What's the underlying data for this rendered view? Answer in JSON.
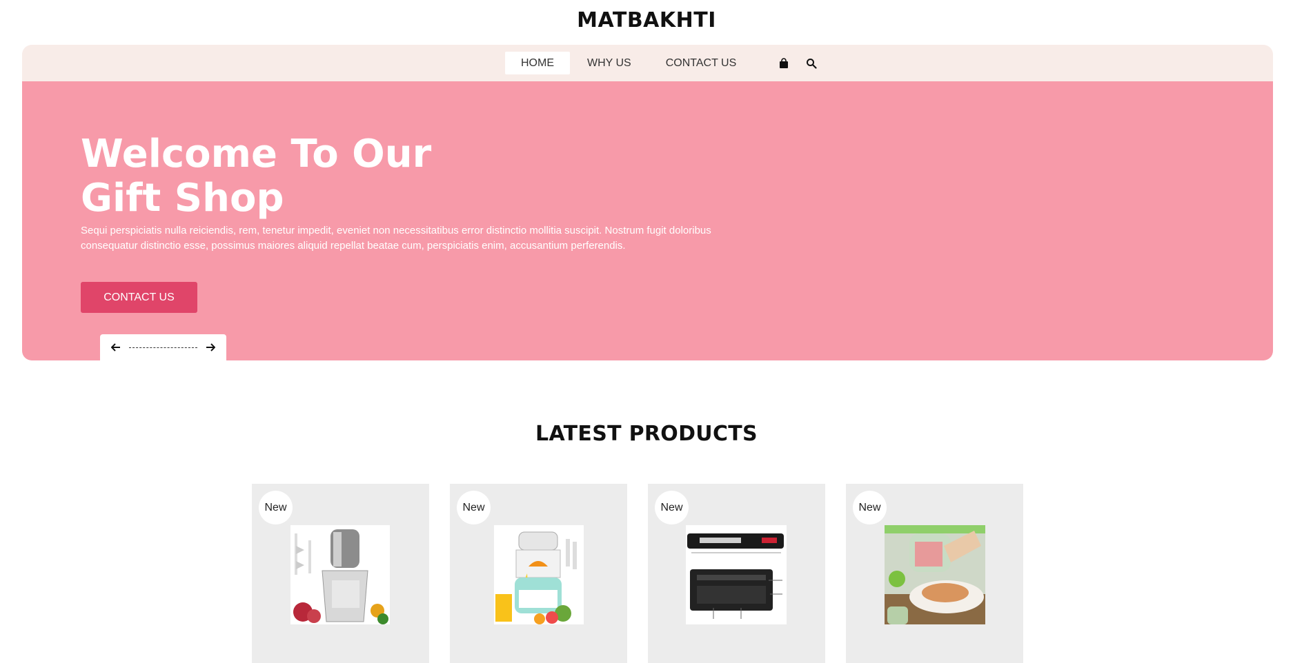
{
  "brand": {
    "name": "MATBAKHTI"
  },
  "nav": {
    "items": [
      {
        "label": "HOME",
        "active": true
      },
      {
        "label": "WHY US",
        "active": false
      },
      {
        "label": "CONTACT US",
        "active": false
      }
    ],
    "icons": [
      "shopping-bag-icon",
      "search-icon"
    ]
  },
  "hero": {
    "title_line1": "Welcome To Our",
    "title_line2": "Gift Shop",
    "text": "Sequi perspiciatis nulla reiciendis, rem, tenetur impedit, eveniet non necessitatibus error distinctio mollitia suscipit. Nostrum fugit doloribus consequatur distinctio esse, possimus maiores aliquid repellat beatae cum, perspiciatis enim, accusantium perferendis.",
    "button_label": "CONTACT US",
    "background_color": "#f79aa9",
    "button_color": "#e04569"
  },
  "products": {
    "title": "LATEST PRODUCTS",
    "items": [
      {
        "badge": "New",
        "image": "electric-food-chopper"
      },
      {
        "badge": "New",
        "image": "citrus-juicer"
      },
      {
        "badge": "New",
        "image": "vacuum-sealer"
      },
      {
        "badge": "New",
        "image": "handheld-vegetable-cutter"
      }
    ]
  }
}
